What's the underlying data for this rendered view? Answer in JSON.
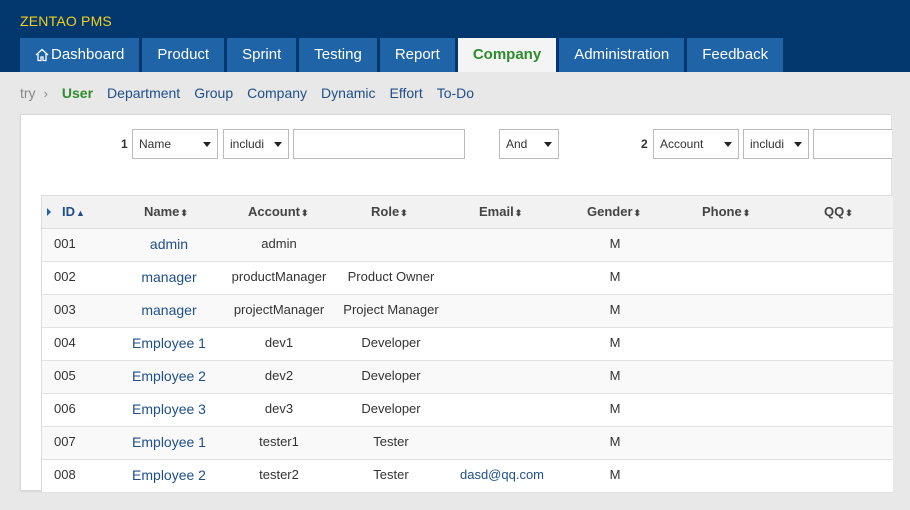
{
  "app": {
    "brand": "ZENTAO PMS"
  },
  "nav": {
    "items": [
      {
        "label": "Dashboard"
      },
      {
        "label": "Product"
      },
      {
        "label": "Sprint"
      },
      {
        "label": "Testing"
      },
      {
        "label": "Report"
      },
      {
        "label": "Company"
      },
      {
        "label": "Administration"
      },
      {
        "label": "Feedback"
      }
    ],
    "active": "Company"
  },
  "subnav": {
    "crumb": "try",
    "items": [
      "User",
      "Department",
      "Group",
      "Company",
      "Dynamic",
      "Effort",
      "To-Do"
    ],
    "active": "User"
  },
  "search": {
    "group1": {
      "num": "1",
      "field": "Name",
      "operator": "includi",
      "value": ""
    },
    "andor": "And",
    "group2": {
      "num": "2",
      "field": "Account",
      "operator": "includi",
      "value": ""
    }
  },
  "table": {
    "columns": [
      "ID",
      "Name",
      "Account",
      "Role",
      "Email",
      "Gender",
      "Phone",
      "QQ"
    ],
    "sort_indicator_asc": "▲",
    "sort_indicator_both": "⬍",
    "rows": [
      {
        "id": "001",
        "name": "admin",
        "account": "admin",
        "role": "",
        "email": "",
        "gender": "M",
        "phone": "",
        "qq": ""
      },
      {
        "id": "002",
        "name": "manager",
        "account": "productManager",
        "role": "Product Owner",
        "email": "",
        "gender": "M",
        "phone": "",
        "qq": ""
      },
      {
        "id": "003",
        "name": "manager",
        "account": "projectManager",
        "role": "Project Manager",
        "email": "",
        "gender": "M",
        "phone": "",
        "qq": ""
      },
      {
        "id": "004",
        "name": "Employee 1",
        "account": "dev1",
        "role": "Developer",
        "email": "",
        "gender": "M",
        "phone": "",
        "qq": ""
      },
      {
        "id": "005",
        "name": "Employee 2",
        "account": "dev2",
        "role": "Developer",
        "email": "",
        "gender": "M",
        "phone": "",
        "qq": ""
      },
      {
        "id": "006",
        "name": "Employee 3",
        "account": "dev3",
        "role": "Developer",
        "email": "",
        "gender": "M",
        "phone": "",
        "qq": ""
      },
      {
        "id": "007",
        "name": "Employee 1",
        "account": "tester1",
        "role": "Tester",
        "email": "",
        "gender": "M",
        "phone": "",
        "qq": ""
      },
      {
        "id": "008",
        "name": "Employee 2",
        "account": "tester2",
        "role": "Tester",
        "email": "dasd@qq.com",
        "gender": "M",
        "phone": "",
        "qq": ""
      }
    ]
  },
  "colors": {
    "topbar": "#03386e",
    "brand": "#f5d11b",
    "nav_tab": "#1f64a6",
    "active_green": "#2e8b2e",
    "link_blue": "#1f4f8a"
  },
  "icons": {
    "dashboard": "home-icon"
  }
}
